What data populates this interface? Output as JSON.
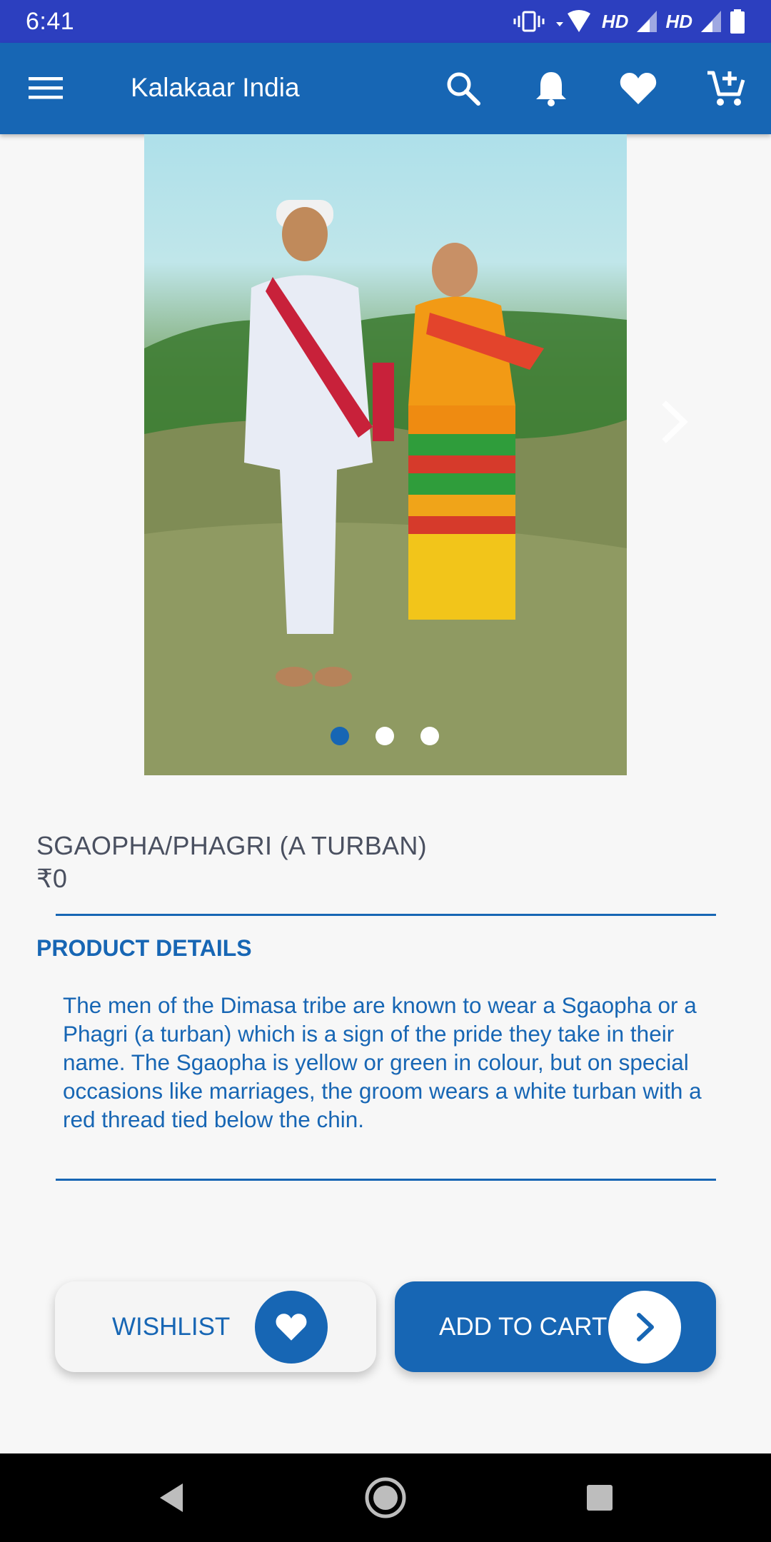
{
  "status_bar": {
    "time": "6:41",
    "hd_label_1": "HD",
    "hd_label_2": "HD"
  },
  "app_bar": {
    "title": "Kalakaar India"
  },
  "gallery": {
    "slide_count": 3,
    "active_index": 0
  },
  "product": {
    "title": "SGAOPHA/PHAGRI (A TURBAN)",
    "price": "₹0",
    "details_heading": "PRODUCT DETAILS",
    "description": "The men of the Dimasa tribe are known to wear a Sgaopha or a Phagri (a turban) which is a sign of the pride they take in their name. The Sgaopha is yellow or green in colour, but on special occasions like marriages, the groom wears a white turban with a red thread tied below the chin."
  },
  "actions": {
    "wishlist_label": "WISHLIST",
    "add_to_cart_label": "ADD TO CART"
  },
  "colors": {
    "primary": "#1766b4",
    "status_bar": "#2c3fbf",
    "text_dark": "#4a5060"
  }
}
